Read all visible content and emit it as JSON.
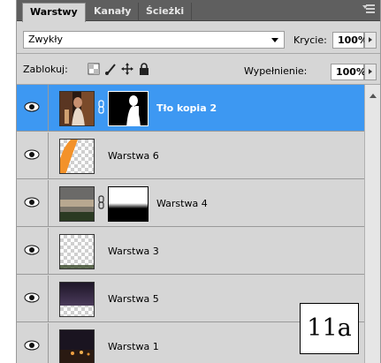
{
  "tabs": [
    {
      "label": "Warstwy",
      "active": true
    },
    {
      "label": "Kanały",
      "active": false
    },
    {
      "label": "Ścieżki",
      "active": false
    }
  ],
  "blend": {
    "mode": "Zwykły",
    "opacity_label": "Krycie:",
    "opacity_value": "100%"
  },
  "lock": {
    "label": "Zablokuj:",
    "fill_label": "Wypełnienie:",
    "fill_value": "100%"
  },
  "layers": [
    {
      "name": "Tło kopia 2",
      "selected": true,
      "has_mask": true
    },
    {
      "name": "Warstwa 6",
      "selected": false,
      "has_mask": false
    },
    {
      "name": "Warstwa 4",
      "selected": false,
      "has_mask": true
    },
    {
      "name": "Warstwa 3",
      "selected": false,
      "has_mask": false
    },
    {
      "name": "Warstwa 5",
      "selected": false,
      "has_mask": false
    },
    {
      "name": "Warstwa 1",
      "selected": false,
      "has_mask": false
    }
  ],
  "badge": "11a",
  "colors": {
    "selection": "#3d98f2",
    "panel": "#d6d6d6",
    "tabbar": "#5f5f5f"
  },
  "icons": [
    "panel-menu-icon",
    "eye-icon",
    "chain-link-icon",
    "lock-transparent-icon",
    "lock-brush-icon",
    "lock-move-icon",
    "lock-all-icon"
  ]
}
